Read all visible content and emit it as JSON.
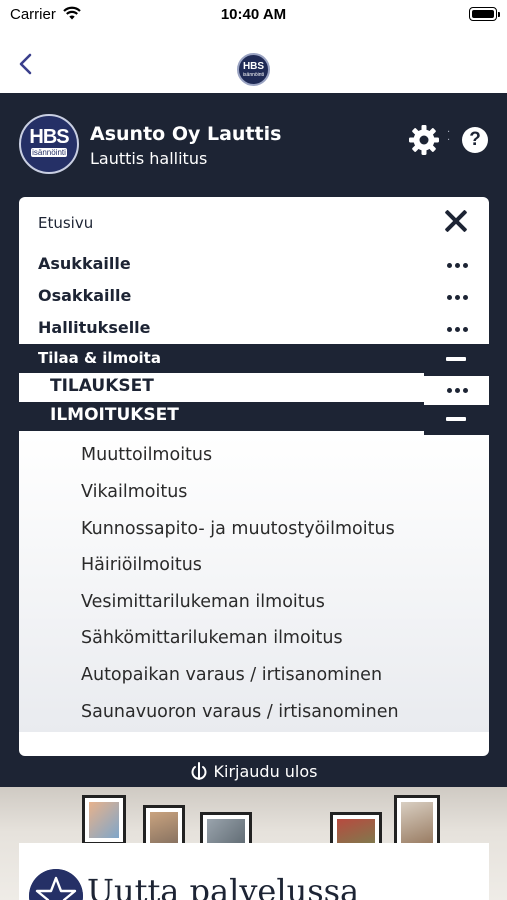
{
  "status_bar": {
    "carrier": "Carrier",
    "time": "10:40 AM"
  },
  "nav": {
    "back_icon": "chevron-left-icon",
    "logo": "HBS",
    "logo_sub": "isännöinti"
  },
  "header": {
    "logo": "HBS",
    "logo_sub": "isännöinti",
    "org_name": "Asunto Oy Lauttis",
    "org_sub": "Lauttis hallitus",
    "settings_icon": "gear-icon",
    "help_label": "?"
  },
  "menu": {
    "title": "Etusivu",
    "items": [
      {
        "label": "Asukkaille"
      },
      {
        "label": "Osakkaille"
      },
      {
        "label": "Hallitukselle"
      }
    ],
    "section": {
      "label": "Tilaa & ilmoita",
      "tilaukset": "TILAUKSET",
      "ilmoitukset": "ILMOITUKSET",
      "notifications": [
        "Muuttoilmoitus",
        "Vikailmoitus",
        "Kunnossapito- ja muutostyöilmoitus",
        "Häiriöilmoitus",
        "Vesimittarilukeman ilmoitus",
        "Sähkömittarilukeman ilmoitus",
        "Autopaikan varaus / irtisanominen",
        "Saunavuoron varaus / irtisanominen"
      ]
    }
  },
  "logout": {
    "label": "Kirjaudu ulos"
  },
  "news": {
    "title": "Uutta palvelussa"
  },
  "colors": {
    "navy": "#1d2434",
    "brand": "#253066",
    "accent": "#3a3f8c"
  }
}
